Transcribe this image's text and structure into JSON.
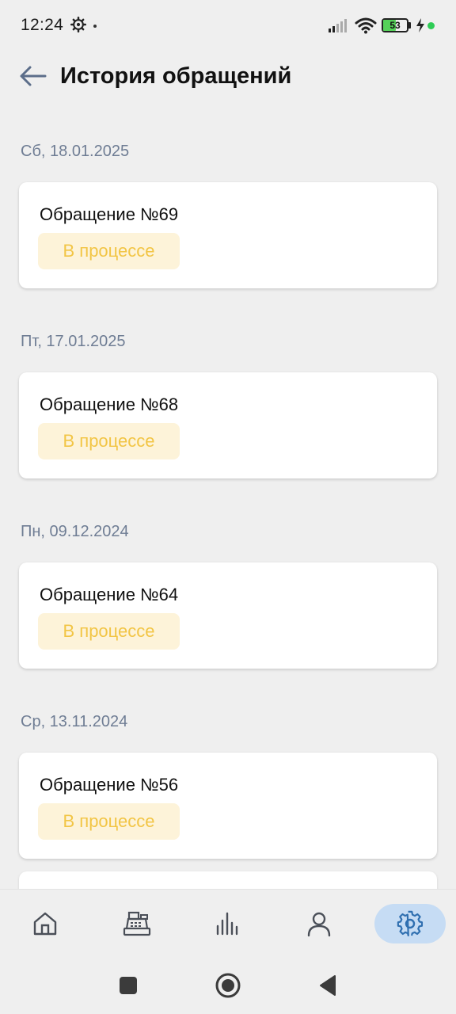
{
  "status_bar": {
    "time": "12:24",
    "battery_level": "53",
    "icons": [
      "gear-icon",
      "signal-icon",
      "wifi-icon",
      "battery-icon",
      "charging-bolt-icon"
    ]
  },
  "header": {
    "title": "История обращений",
    "back_icon": "arrow-left-icon"
  },
  "requests": [
    {
      "date": "Сб, 18.01.2025",
      "title": "Обращение №69",
      "status": "В процессе"
    },
    {
      "date": "Пт, 17.01.2025",
      "title": "Обращение №68",
      "status": "В процессе"
    },
    {
      "date": "Пн, 09.12.2024",
      "title": "Обращение №64",
      "status": "В процессе"
    },
    {
      "date": "Ср, 13.11.2024",
      "title": "Обращение №56",
      "status": "В процессе"
    }
  ],
  "bottom_nav": {
    "items": [
      {
        "icon": "home-icon",
        "active": false
      },
      {
        "icon": "cash-register-icon",
        "active": false
      },
      {
        "icon": "bar-chart-icon",
        "active": false
      },
      {
        "icon": "user-icon",
        "active": false
      },
      {
        "icon": "settings-gear-icon",
        "active": true
      }
    ]
  },
  "system_nav": {
    "items": [
      "recents-square-icon",
      "home-circle-icon",
      "back-triangle-icon"
    ]
  },
  "colors": {
    "background": "#efefef",
    "card": "#ffffff",
    "date_label": "#6f7d94",
    "status_badge_bg": "#fdf3d9",
    "status_text": "#f2c545",
    "active_nav_bg": "#c6dcf4",
    "active_nav_icon": "#2f6fb0",
    "nav_icon": "#4a4f58"
  }
}
